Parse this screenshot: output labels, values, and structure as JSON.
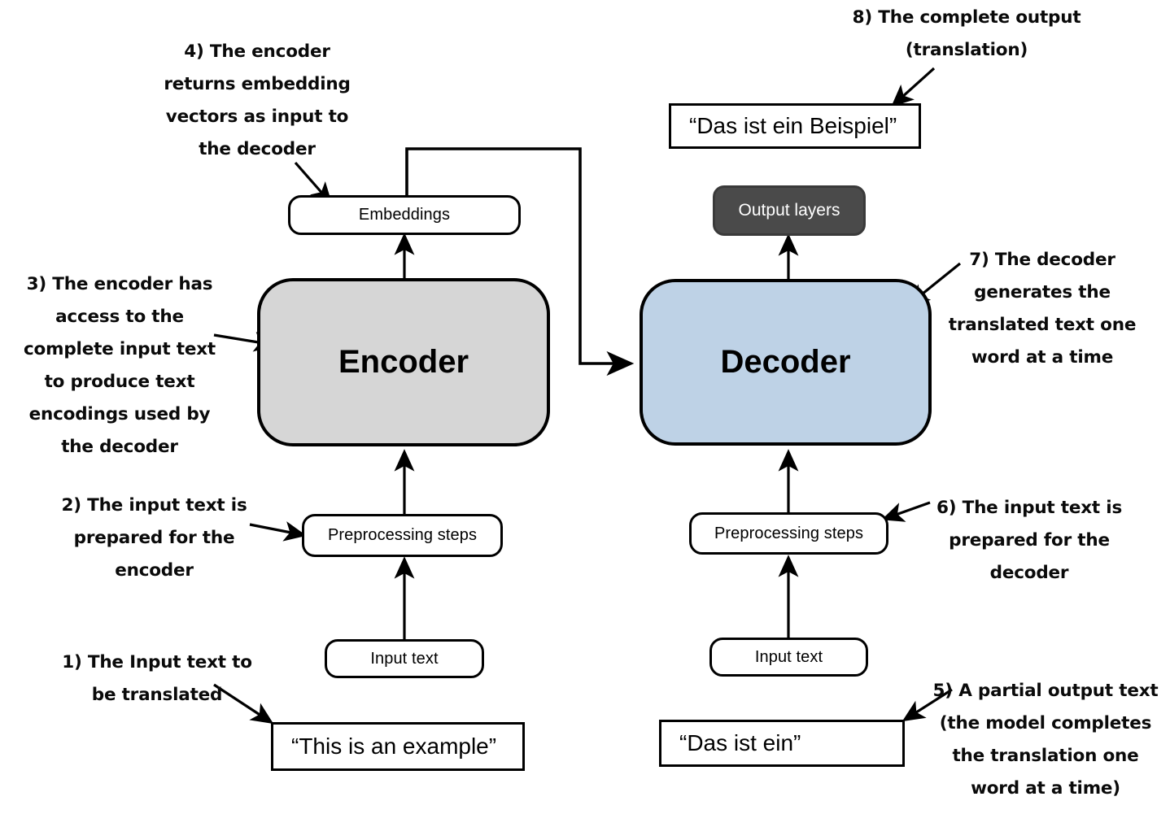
{
  "diagram": {
    "title": "Encoder-decoder translation pipeline",
    "colors": {
      "encoder_fill": "#d6d6d6",
      "decoder_fill": "#bed2e6",
      "output_layers_fill": "#4a4a4a",
      "stroke": "#000000",
      "background": "#ffffff"
    },
    "nodes": {
      "encoder": "Encoder",
      "decoder": "Decoder",
      "embeddings": "Embeddings",
      "output_layers": "Output layers",
      "preprocessing_left": "Preprocessing steps",
      "preprocessing_right": "Preprocessing steps",
      "input_text_left": "Input text",
      "input_text_right": "Input text",
      "source_text": "“This is an example”",
      "partial_output_text": "“Das ist ein”",
      "complete_output_text": "“Das ist ein Beispiel”"
    },
    "annotations": [
      {
        "id": "step-1",
        "number": "1)",
        "text": "1) The Input text to\nbe translated"
      },
      {
        "id": "step-2",
        "number": "2)",
        "text": "2) The input text is\nprepared for the\nencoder"
      },
      {
        "id": "step-3",
        "number": "3)",
        "text": "3) The encoder has\naccess to the\ncomplete input text\nto produce text\nencodings used by\nthe decoder"
      },
      {
        "id": "step-4",
        "number": "4)",
        "text": "4) The encoder\nreturns embedding\nvectors as input to\nthe decoder"
      },
      {
        "id": "step-5",
        "number": "5)",
        "text": "5) A partial output text\n(the model completes\nthe translation one\nword at a time)"
      },
      {
        "id": "step-6",
        "number": "6)",
        "text": "6) The input text is\nprepared for the\ndecoder"
      },
      {
        "id": "step-7",
        "number": "7)",
        "text": "7) The decoder\ngenerates the\ntranslated text one\nword at a time"
      },
      {
        "id": "step-8",
        "number": "8)",
        "text": "8) The complete output\n(translation)"
      }
    ]
  }
}
